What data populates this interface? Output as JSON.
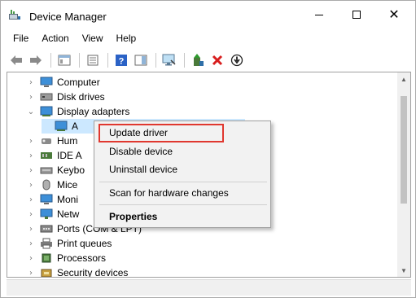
{
  "window": {
    "title": "Device Manager",
    "controls": {
      "minimize": "minimize",
      "maximize": "maximize",
      "close": "✕"
    }
  },
  "menu": [
    "File",
    "Action",
    "View",
    "Help"
  ],
  "toolbar": {
    "buttons": [
      "back-arrow",
      "forward-arrow",
      "show-hide-tree",
      "properties",
      "help",
      "update-driver-monitor",
      "enable-device",
      "uninstall-device",
      "download"
    ]
  },
  "tree": {
    "items": [
      {
        "label": "Computer",
        "expander": "collapsed",
        "icon": "computer-icon"
      },
      {
        "label": "Disk drives",
        "expander": "collapsed",
        "icon": "disk-drive-icon"
      },
      {
        "label": "Display adapters",
        "expander": "expanded",
        "icon": "display-adapter-icon"
      },
      {
        "label": "A",
        "expander": "none",
        "icon": "display-adapter-icon",
        "selected": true
      },
      {
        "label": "Hum",
        "expander": "collapsed",
        "icon": "hid-icon"
      },
      {
        "label": "IDE A",
        "expander": "collapsed",
        "icon": "ide-icon"
      },
      {
        "label": "Keybo",
        "expander": "collapsed",
        "icon": "keyboard-icon"
      },
      {
        "label": "Mice",
        "expander": "collapsed",
        "icon": "mouse-icon"
      },
      {
        "label": "Moni",
        "expander": "collapsed",
        "icon": "monitor-icon"
      },
      {
        "label": "Netw",
        "expander": "collapsed",
        "icon": "network-icon"
      },
      {
        "label": "Ports (COM & LPT)",
        "expander": "collapsed",
        "icon": "port-icon"
      },
      {
        "label": "Print queues",
        "expander": "collapsed",
        "icon": "printer-icon"
      },
      {
        "label": "Processors",
        "expander": "collapsed",
        "icon": "processor-icon"
      },
      {
        "label": "Security devices",
        "expander": "collapsed",
        "icon": "security-icon"
      }
    ]
  },
  "context_menu": {
    "items": [
      {
        "label": "Update driver",
        "bold": false,
        "highlighted": true
      },
      {
        "label": "Disable device",
        "bold": false
      },
      {
        "label": "Uninstall device",
        "bold": false
      },
      {
        "label": "Scan for hardware changes",
        "bold": false
      },
      {
        "label": "Properties",
        "bold": true
      }
    ],
    "highlight_color": "#e0382f"
  },
  "colors": {
    "selection": "#cce8ff",
    "menu_bg": "#f2f2f2",
    "highlight_border": "#e0382f"
  }
}
